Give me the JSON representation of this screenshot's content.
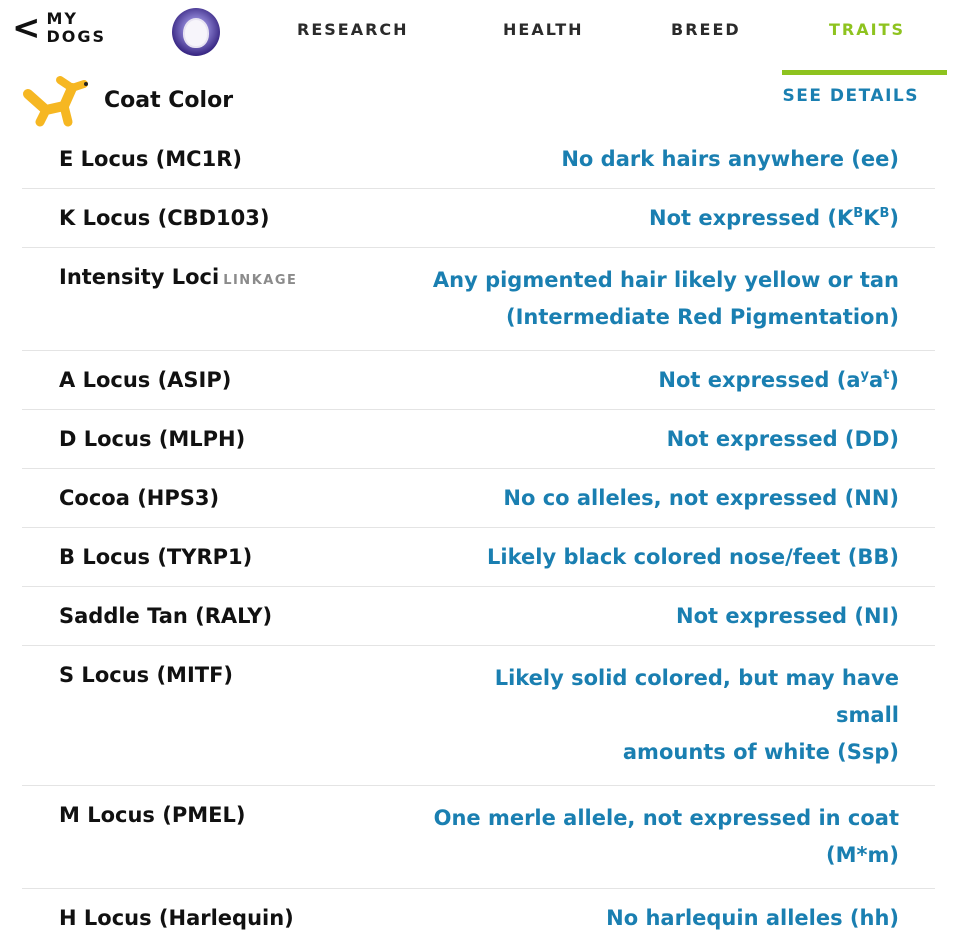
{
  "nav": {
    "back_label": "MY DOGS",
    "tabs": [
      {
        "label": "RESEARCH",
        "active": false
      },
      {
        "label": "HEALTH",
        "active": false
      },
      {
        "label": "BREED",
        "active": false
      },
      {
        "label": "TRAITS",
        "active": true
      }
    ],
    "accent_color": "#8ec31f"
  },
  "section": {
    "title": "Coat Color",
    "see_details": "SEE DETAILS",
    "link_color": "#1a7fb1"
  },
  "loci": [
    {
      "label": "E Locus (MC1R)",
      "value": "No dark hairs anywhere (ee)"
    },
    {
      "label": "K Locus (CBD103)",
      "value_prefix": "Not expressed (K",
      "sup1": "B",
      "value_mid": "K",
      "sup2": "B",
      "value_suffix": ")"
    },
    {
      "label": "Intensity Loci",
      "tag": "LINKAGE",
      "value_line1": "Any pigmented hair likely yellow or tan",
      "value_line2": "(Intermediate Red Pigmentation)"
    },
    {
      "label": "A Locus (ASIP)",
      "value_prefix": "Not expressed (a",
      "sup1": "y",
      "value_mid": "a",
      "sup2": "t",
      "value_suffix": ")"
    },
    {
      "label": "D Locus (MLPH)",
      "value": "Not expressed (DD)"
    },
    {
      "label": "Cocoa (HPS3)",
      "value": "No co alleles, not expressed (NN)"
    },
    {
      "label": "B Locus (TYRP1)",
      "value": "Likely black colored nose/feet (BB)"
    },
    {
      "label": "Saddle Tan (RALY)",
      "value": "Not expressed (NI)"
    },
    {
      "label": "S Locus (MITF)",
      "value_line1": "Likely solid colored, but may have small",
      "value_line2": "amounts of white (Ssp)"
    },
    {
      "label": "M Locus (PMEL)",
      "value_line1": "One merle allele, not expressed in coat",
      "value_line2": "(M*m)"
    },
    {
      "label": "H Locus (Harlequin)",
      "value": "No harlequin alleles (hh)"
    }
  ]
}
